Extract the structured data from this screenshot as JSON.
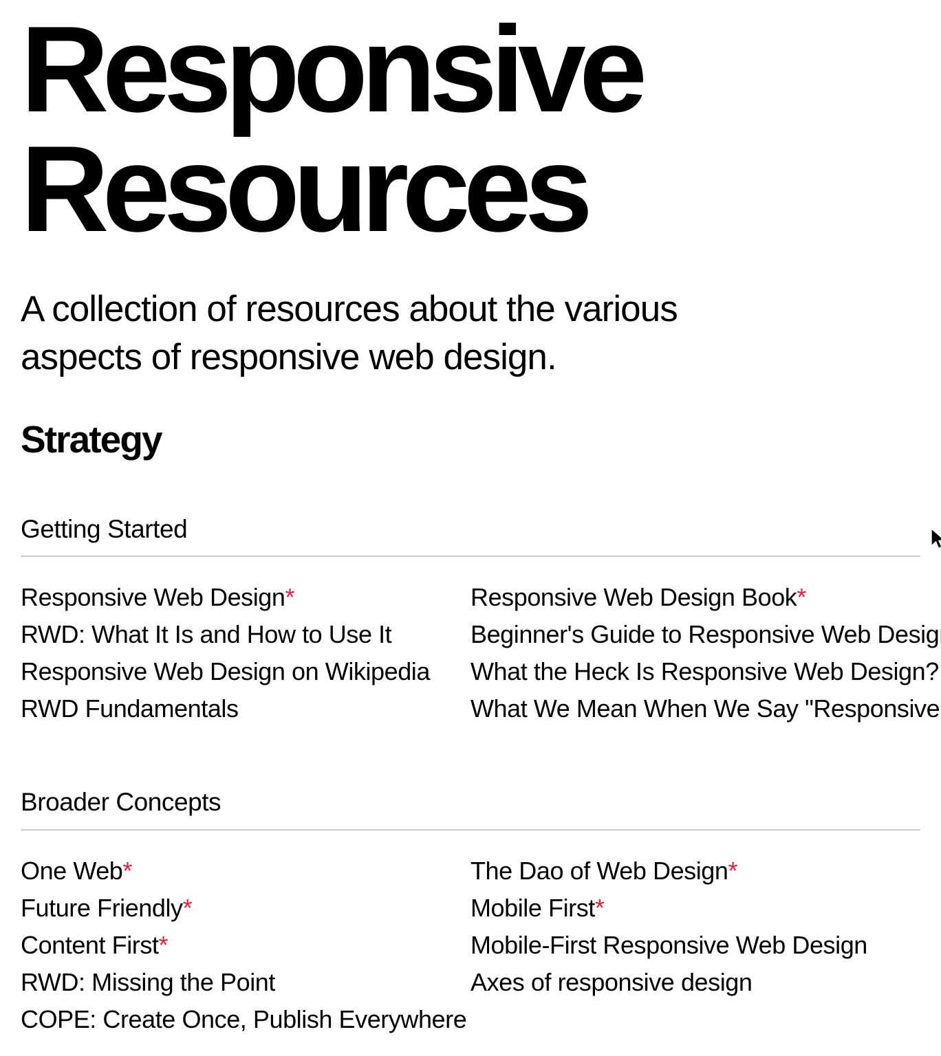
{
  "colors": {
    "background": "#ffffff",
    "text": "#000000",
    "accent_star": "#e8203c",
    "rule": "#cccccc"
  },
  "header": {
    "title": "Responsive Resources",
    "subtitle": "A collection of resources about the various aspects of responsive web design."
  },
  "section": {
    "title": "Strategy"
  },
  "star_marker": "*",
  "subsections": [
    {
      "title": "Getting Started",
      "columns": [
        {
          "items": [
            {
              "label": "Responsive Web Design",
              "starred": true
            },
            {
              "label": "RWD: What It Is and How to Use It",
              "starred": false
            },
            {
              "label": "Responsive Web Design on Wikipedia",
              "starred": false
            },
            {
              "label": "RWD Fundamentals",
              "starred": false
            }
          ]
        },
        {
          "items": [
            {
              "label": "Responsive Web Design Book",
              "starred": true
            },
            {
              "label": "Beginner's Guide to Responsive Web Design",
              "starred": false
            },
            {
              "label": "What the Heck Is Responsive Web Design?",
              "starred": false
            },
            {
              "label": "What We Mean When We Say \"Responsive\"",
              "starred": false
            }
          ]
        }
      ]
    },
    {
      "title": "Broader Concepts",
      "columns": [
        {
          "items": [
            {
              "label": "One Web",
              "starred": true
            },
            {
              "label": "Future Friendly",
              "starred": true
            },
            {
              "label": "Content First",
              "starred": true
            },
            {
              "label": "RWD: Missing the Point",
              "starred": false
            },
            {
              "label": "COPE: Create Once, Publish Everywhere",
              "starred": false
            }
          ]
        },
        {
          "items": [
            {
              "label": "The Dao of Web Design",
              "starred": true
            },
            {
              "label": "Mobile First",
              "starred": true
            },
            {
              "label": "Mobile-First Responsive Web Design",
              "starred": false
            },
            {
              "label": "Axes of responsive design",
              "starred": false
            }
          ]
        }
      ]
    }
  ],
  "cursor": {
    "icon": "mouse-pointer-icon"
  }
}
